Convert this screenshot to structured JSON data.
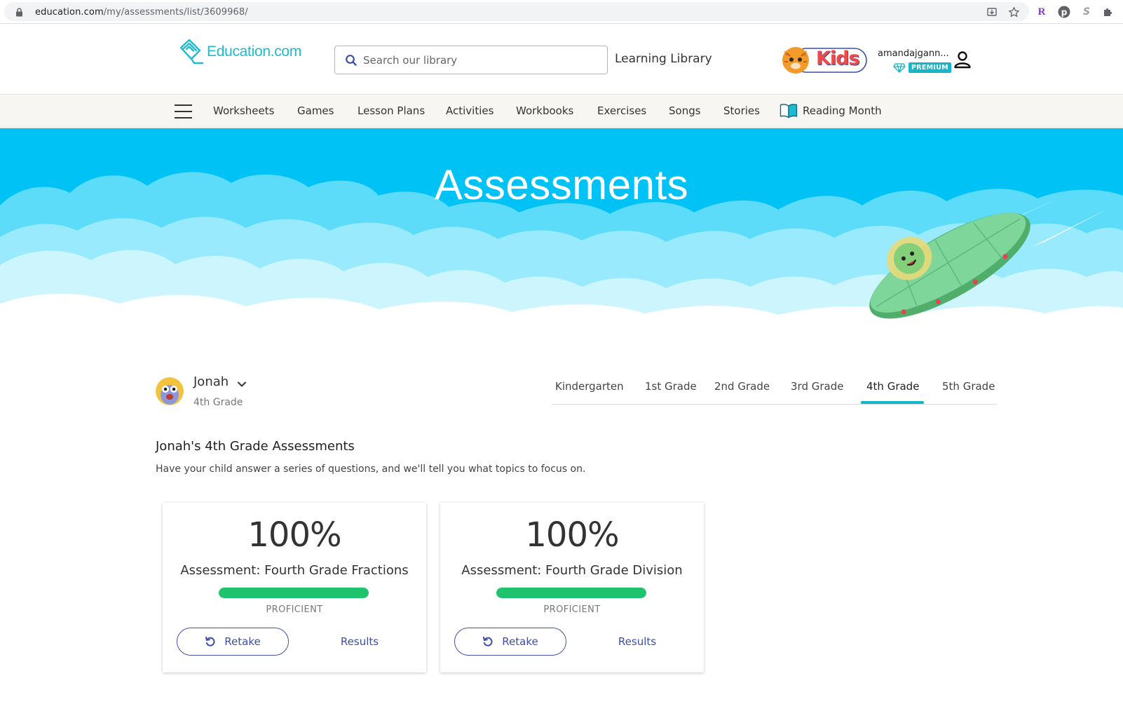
{
  "browser": {
    "url_host": "education.com",
    "url_path": "/my/assessments/list/3609968/"
  },
  "header": {
    "logo_text": "Education.com",
    "search_placeholder": "Search our library",
    "learning_library": "Learning Library",
    "kids_label": "Kids",
    "user_name": "amandajgann...",
    "premium_label": "PREMIUM"
  },
  "nav": {
    "items": [
      "Worksheets",
      "Games",
      "Lesson Plans",
      "Activities",
      "Workbooks",
      "Exercises",
      "Songs",
      "Stories",
      "Reading Month"
    ]
  },
  "hero": {
    "title": "Assessments"
  },
  "profile": {
    "name": "Jonah",
    "grade": "4th Grade"
  },
  "grade_tabs": {
    "items": [
      "Kindergarten",
      "1st Grade",
      "2nd Grade",
      "3rd Grade",
      "4th Grade",
      "5th Grade"
    ],
    "active": "4th Grade"
  },
  "section": {
    "title": "Jonah's 4th Grade Assessments",
    "subtitle": "Have your child answer a series of questions, and we'll tell you what topics to focus on."
  },
  "cards": [
    {
      "score": "100%",
      "title": "Assessment: Fourth Grade Fractions",
      "progress": 1.0,
      "status": "PROFICIENT",
      "retake": "Retake",
      "results": "Results"
    },
    {
      "score": "100%",
      "title": "Assessment: Fourth Grade Division",
      "progress": 1.0,
      "status": "PROFICIENT",
      "retake": "Retake",
      "results": "Results"
    }
  ],
  "colors": {
    "accent": "#1ebbd0",
    "hero_sky": "#00c2f5",
    "progress": "#1ec46d",
    "button": "#3d4fa6",
    "premium": "#18b4c8"
  }
}
